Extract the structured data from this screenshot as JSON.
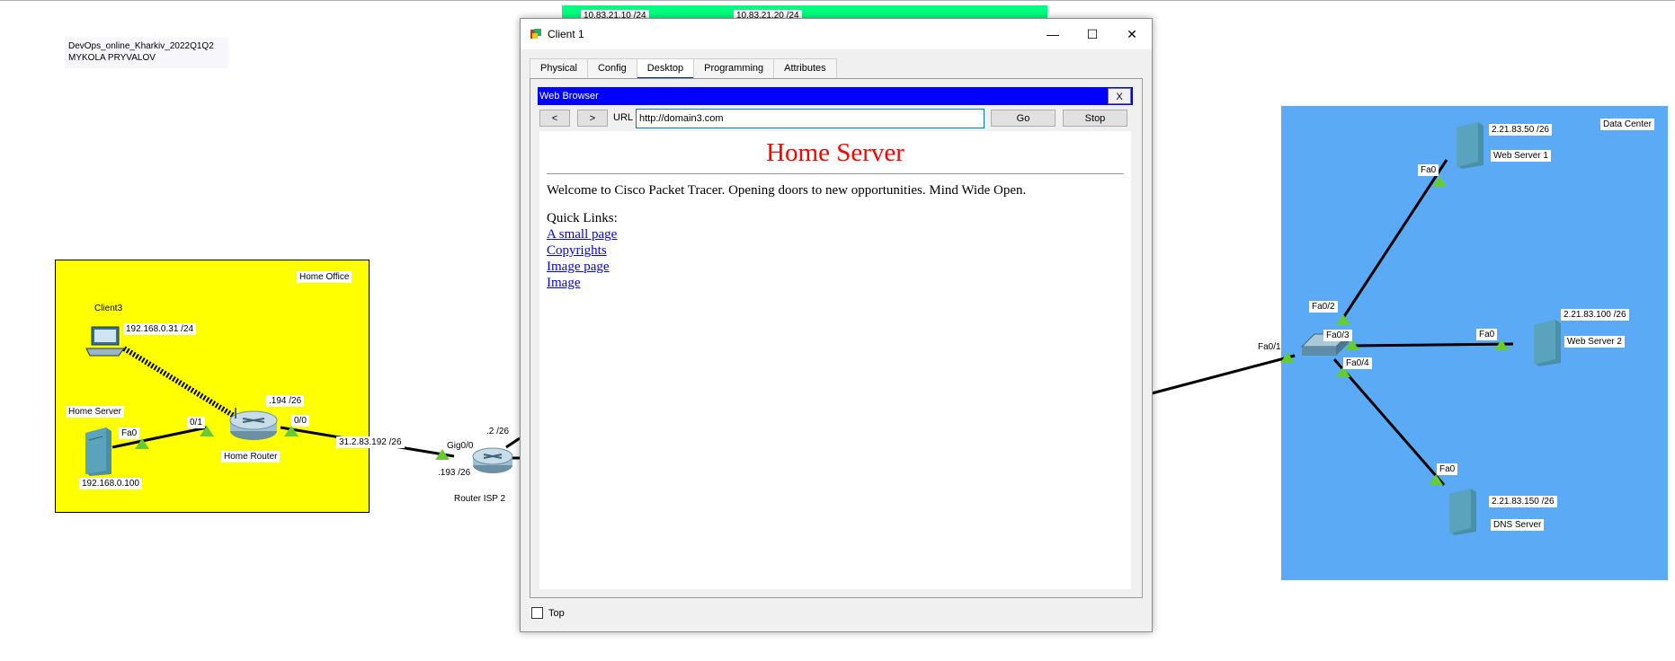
{
  "workspace": {
    "note_line1": "DevOps_online_Kharkiv_2022Q1Q2",
    "note_line2": "MYKOLA PRYVALOV",
    "top_labels": [
      "10.83.21.10 /24",
      "10.83.21.20 /24"
    ],
    "colors": {
      "home_office": "#ffff00",
      "data_center": "#5aaaf5",
      "top_network": "#00ff7f",
      "link_up": "#66cc33",
      "cable": "#000000"
    }
  },
  "home_office": {
    "area_label": "Home Office",
    "client3": {
      "name": "Client3",
      "ip": "192.168.0.31 /24",
      "icon": "laptop-icon"
    },
    "home_server": {
      "name": "Home Server",
      "ip": "192.168.0.100",
      "port": "Fa0",
      "icon": "server-icon"
    },
    "home_router": {
      "name": "Home Router",
      "port_lan": "0/1",
      "port_wan": "0/0",
      "wan_ip": ".194 /26",
      "icon": "router-icon"
    },
    "link_network": "31.2.83.192 /26"
  },
  "isp": {
    "router_name": "Router ISP 2",
    "port": "Gig0/0",
    "ip_left": ".193 /26",
    "ip_top": ".2 /26",
    "icon": "router-icon"
  },
  "data_center": {
    "area_label": "Data Center",
    "switch_ports": [
      "Fa0/1",
      "Fa0/2",
      "Fa0/3",
      "Fa0/4"
    ],
    "web_server1": {
      "name": "Web Server 1",
      "ip": "2.21.83.50 /26",
      "port": "Fa0"
    },
    "web_server2": {
      "name": "Web Server 2",
      "ip": "2.21.83.100 /26",
      "port": "Fa0"
    },
    "dns_server": {
      "name": "DNS Server",
      "ip": "2.21.83.150 /26",
      "port": "Fa0"
    }
  },
  "window": {
    "title": "Client 1",
    "controls": {
      "minimize": "—",
      "maximize": "☐",
      "close": "✕"
    },
    "tabs": [
      {
        "label": "Physical",
        "active": false
      },
      {
        "label": "Config",
        "active": false
      },
      {
        "label": "Desktop",
        "active": true
      },
      {
        "label": "Programming",
        "active": false
      },
      {
        "label": "Attributes",
        "active": false
      }
    ],
    "browser": {
      "title": "Web Browser",
      "close_label": "X",
      "back_label": "<",
      "forward_label": ">",
      "url_label": "URL",
      "url_value": "http://domain3.com",
      "go_label": "Go",
      "stop_label": "Stop",
      "page": {
        "heading": "Home Server",
        "welcome": "Welcome to Cisco Packet Tracer. Opening doors to new opportunities. Mind Wide Open.",
        "quick_links_title": "Quick Links:",
        "links": [
          "A small page",
          "Copyrights",
          "Image page",
          "Image"
        ]
      }
    },
    "top_checkbox_label": "Top",
    "top_checked": false
  }
}
